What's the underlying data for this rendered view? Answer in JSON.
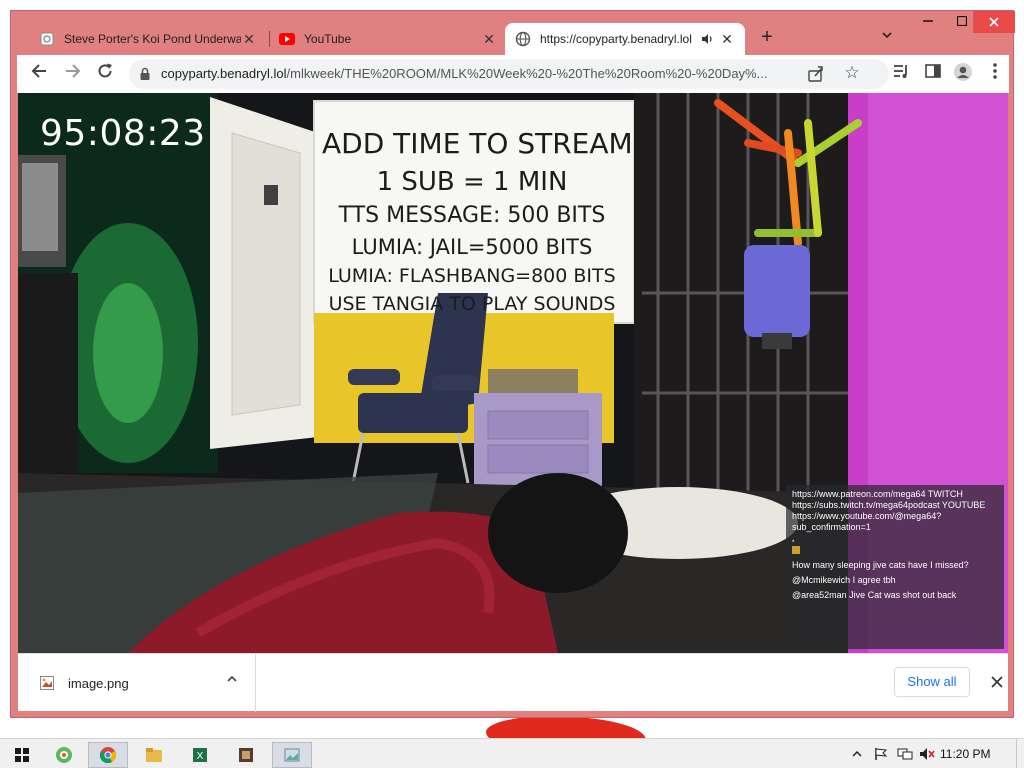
{
  "browser": {
    "tabs": [
      {
        "title": "Steve Porter's Koi Pond Underwater",
        "active": false
      },
      {
        "title": "YouTube",
        "active": false
      },
      {
        "title": "https://copyparty.benadryl.lol",
        "active": true
      }
    ],
    "tab_search_icon": "chevron-down-icon",
    "window_controls": {
      "minimize": "minimize-icon",
      "maximize": "maximize-icon",
      "close": "close-icon"
    }
  },
  "toolbar": {
    "url_host": "copyparty.benadryl.lol",
    "url_path": "/mlkweek/THE%20ROOM/MLK%20Week%20-%20The%20Room%20-%20Day%...",
    "icons": [
      "back-icon",
      "forward-icon",
      "reload-icon",
      "lock-icon",
      "share-icon",
      "star-icon",
      "media-control-icon",
      "side-panel-icon",
      "profile-icon",
      "menu-icon"
    ]
  },
  "stream": {
    "timer": "95:08:23",
    "sign_lines": [
      "ADD TIME TO STREAM",
      "1 SUB = 1   MIN",
      "TTS MESSAGE: 500 BITS",
      "LUMIA: JAIL=5000 BITS",
      "LUMIA: FLASHBANG=800 BITS",
      "USE TANGIA TO PLAY SOUNDS"
    ],
    "chat": {
      "header": "https://www.patreon.com/mega64 TWITCH https://subs.twitch.tv/mega64podcast YOUTUBE https://www.youtube.com/@mega64?sub_confirmation=1",
      "messages": [
        {
          "text": "How many sleeping jive cats have I missed?"
        },
        {
          "text": "@Mcmikewich I agree tbh"
        },
        {
          "text": "@area52man Jive Cat was shot out back"
        }
      ]
    }
  },
  "downloads": {
    "file_name": "image.png",
    "show_all": "Show all"
  },
  "taskbar": {
    "clock": "11:20 PM",
    "pinned": [
      "windows-start-icon",
      "media-player-icon",
      "chrome-icon",
      "file-explorer-icon",
      "excel-icon",
      "video-app-icon",
      "image-viewer-icon"
    ],
    "tray_icons": [
      "tray-chevron-icon",
      "flag-icon",
      "network-icon",
      "volume-muted-icon"
    ]
  },
  "colors": {
    "window_frame": "#e08080",
    "close_button": "#e84a4a",
    "link_blue": "#1a73e8",
    "taskbar": "#f0f0f0"
  }
}
